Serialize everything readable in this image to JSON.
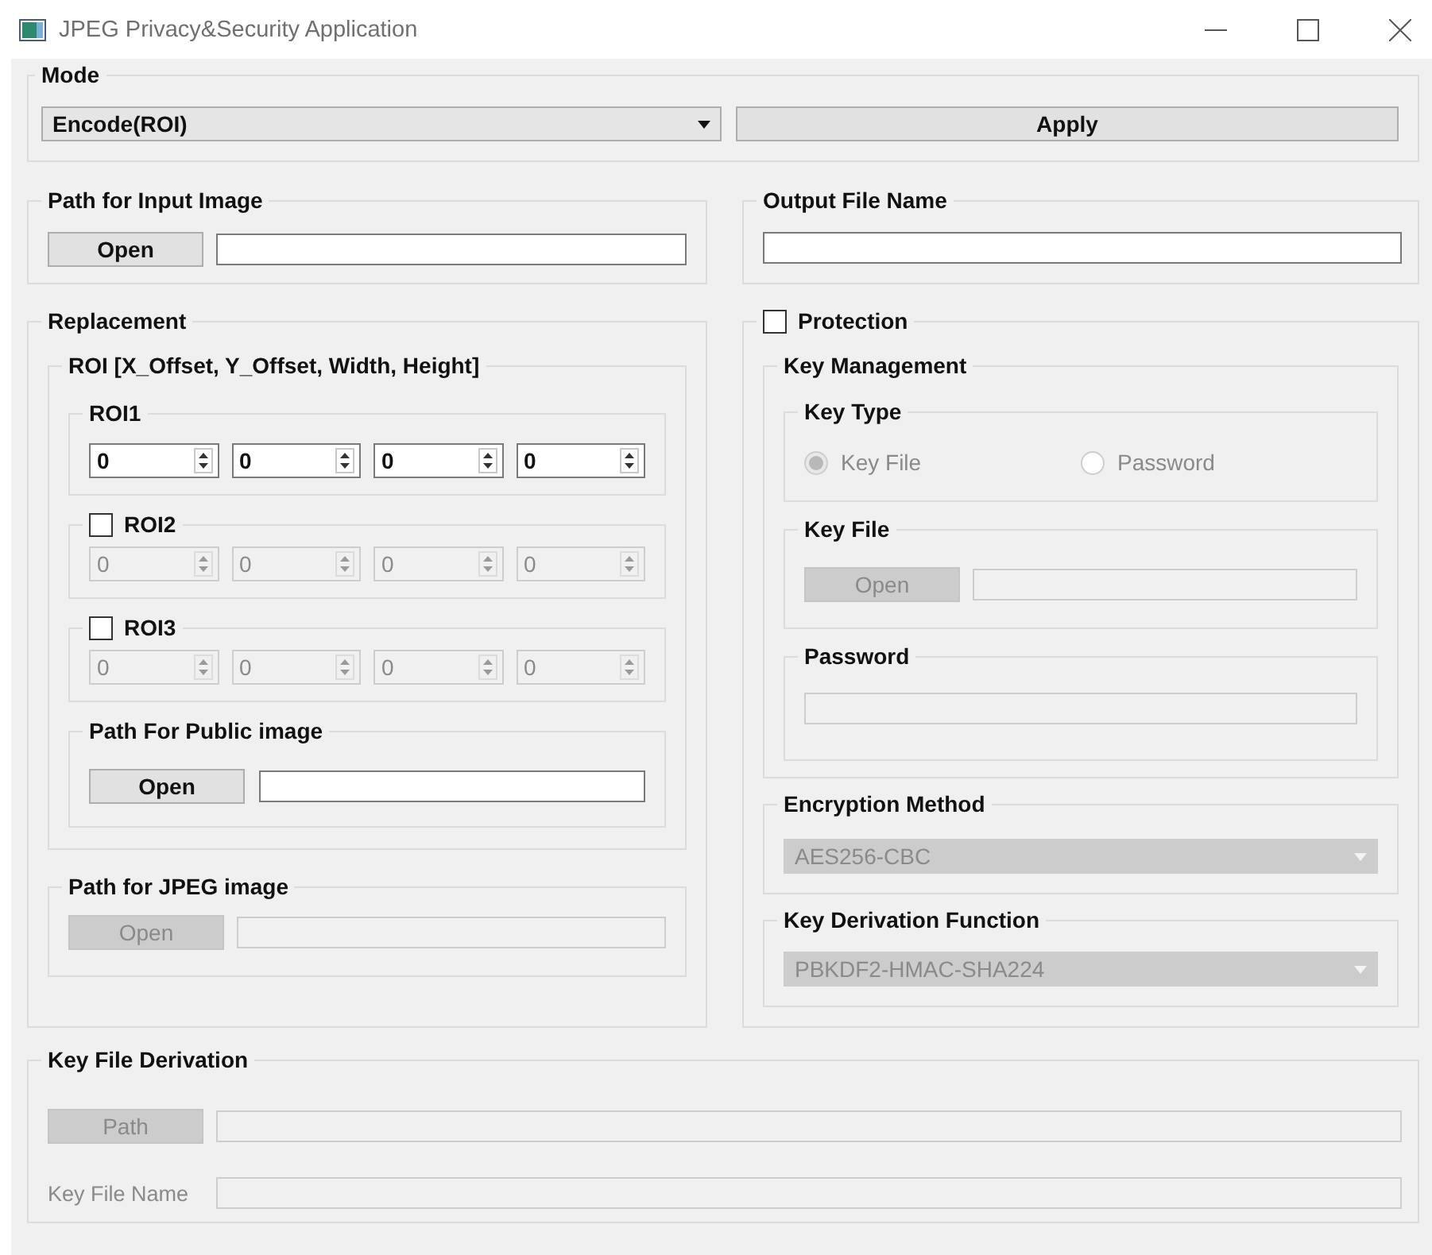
{
  "window": {
    "title": "JPEG Privacy&Security Application"
  },
  "mode": {
    "title": "Mode",
    "dropdown": {
      "value": "Encode(ROI)",
      "disabled": false
    },
    "apply_button": {
      "label": "Apply",
      "disabled": false
    }
  },
  "input_image": {
    "title": "Path for Input Image",
    "button": {
      "label": "Open",
      "disabled": false
    },
    "path_field": {
      "disabled": false
    }
  },
  "output_file": {
    "title": "Output File Name",
    "name_field": {
      "disabled": false
    }
  },
  "replacement": {
    "title": "Replacement",
    "roi": {
      "title": "ROI [X_Offset, Y_Offset, Width, Height]",
      "regions": [
        {
          "kind": "plain",
          "label": "ROI1",
          "disabled": false,
          "values": [
            "0",
            "0",
            "0",
            "0"
          ]
        },
        {
          "kind": "checkbox",
          "label": "ROI2",
          "checked": false,
          "disabled": true,
          "values": [
            "0",
            "0",
            "0",
            "0"
          ]
        },
        {
          "kind": "checkbox",
          "label": "ROI3",
          "checked": false,
          "disabled": true,
          "values": [
            "0",
            "0",
            "0",
            "0"
          ]
        }
      ],
      "public_image": {
        "title": "Path For Public image",
        "button": {
          "label": "Open",
          "disabled": false
        },
        "path_field": {
          "disabled": false
        }
      }
    },
    "jpeg_image": {
      "title": "Path for JPEG image",
      "button": {
        "label": "Open",
        "disabled": true
      },
      "path_field": {
        "disabled": true
      }
    }
  },
  "protection": {
    "label": "Protection",
    "checked": false,
    "key_management": {
      "title": "Key Management",
      "key_type": {
        "title": "Key Type",
        "disabled": true,
        "options": [
          {
            "label": "Key File",
            "selected": true
          },
          {
            "label": "Password",
            "selected": false
          }
        ]
      },
      "key_file": {
        "title": "Key File",
        "button": {
          "label": "Open",
          "disabled": true
        },
        "path_field": {
          "disabled": true
        }
      },
      "password": {
        "title": "Password",
        "field": {
          "disabled": true
        }
      }
    },
    "encryption_method": {
      "title": "Encryption Method",
      "dropdown": {
        "value": "AES256-CBC",
        "disabled": true
      }
    },
    "key_derivation_function": {
      "title": "Key Derivation Function",
      "dropdown": {
        "value": "PBKDF2-HMAC-SHA224",
        "disabled": true
      }
    }
  },
  "key_file_derivation": {
    "title": "Key File Derivation",
    "rows": [
      {
        "kind": "button",
        "label": "Path",
        "disabled": true
      },
      {
        "kind": "label",
        "label": "Key File Name",
        "disabled": true
      }
    ]
  }
}
